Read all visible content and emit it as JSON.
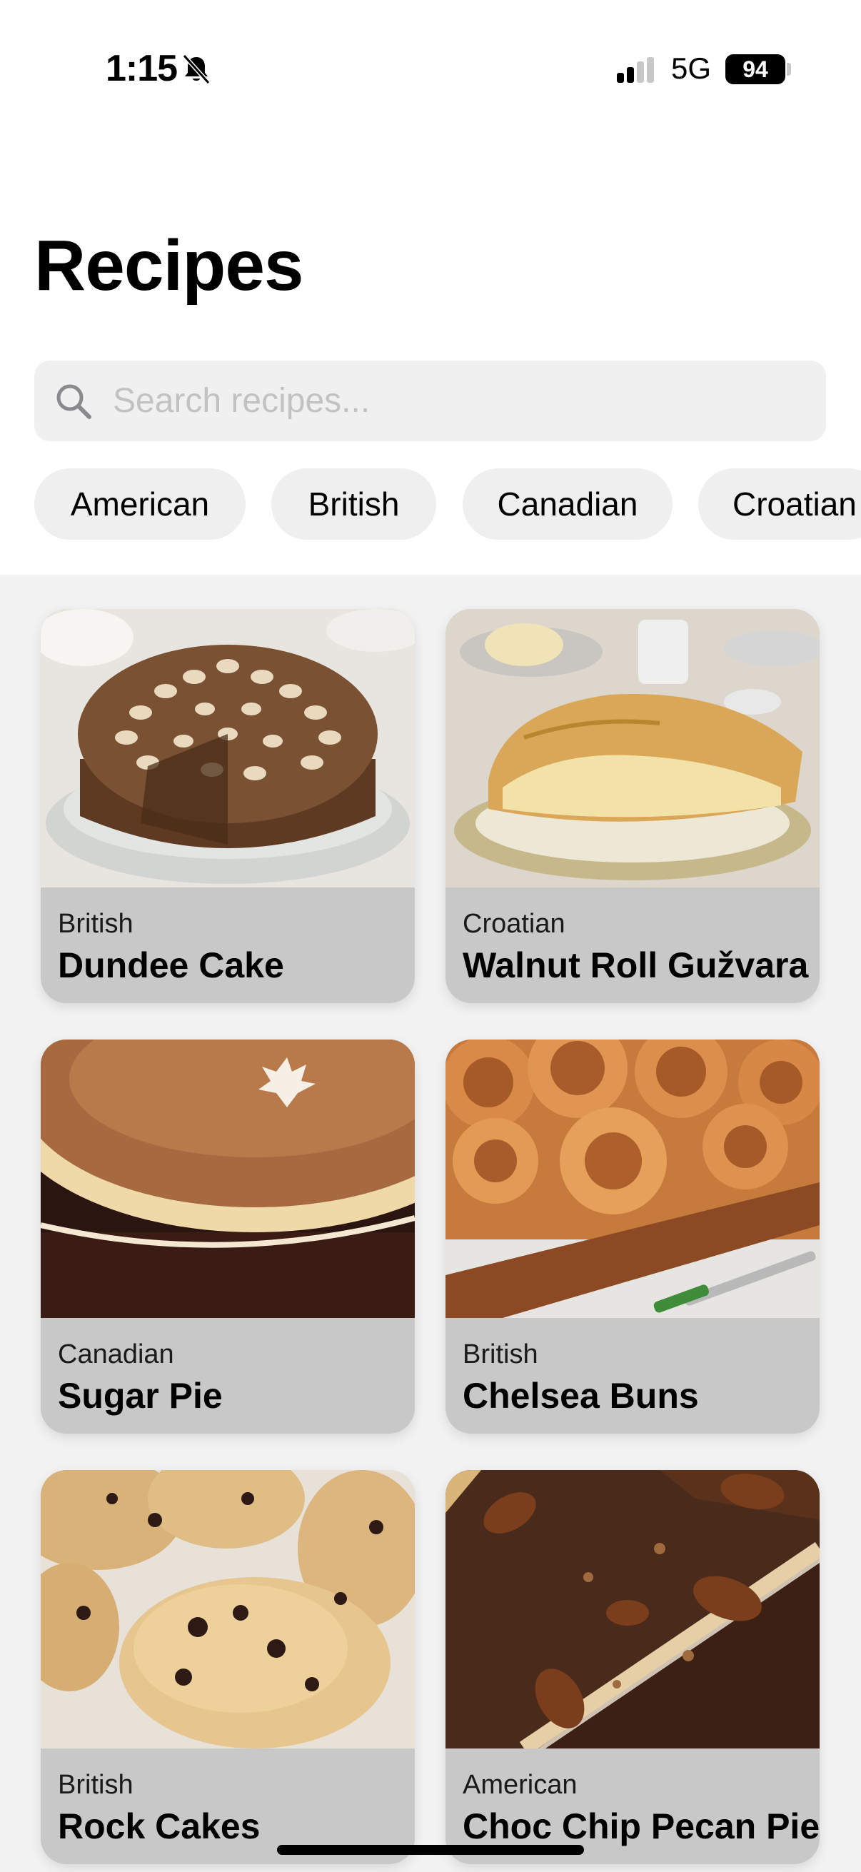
{
  "status_bar": {
    "time": "1:15",
    "network": "5G",
    "battery": "94",
    "icons": [
      "bell-muted-icon",
      "cellular-signal-icon",
      "battery-icon"
    ]
  },
  "header": {
    "title": "Recipes"
  },
  "search": {
    "placeholder": "Search recipes...",
    "value": "",
    "icon": "search-icon"
  },
  "filters": [
    {
      "label": "American"
    },
    {
      "label": "British"
    },
    {
      "label": "Canadian"
    },
    {
      "label": "Croatian"
    }
  ],
  "recipes": [
    {
      "area": "British",
      "name": "Dundee Cake",
      "image": "dundee-cake-photo"
    },
    {
      "area": "Croatian",
      "name": "Walnut Roll Gužvara",
      "image": "walnut-roll-photo"
    },
    {
      "area": "Canadian",
      "name": "Sugar Pie",
      "image": "sugar-pie-photo"
    },
    {
      "area": "British",
      "name": "Chelsea Buns",
      "image": "chelsea-buns-photo"
    },
    {
      "area": "British",
      "name": "Rock Cakes",
      "image": "rock-cakes-photo"
    },
    {
      "area": "American",
      "name": "Choc Chip Pecan Pie",
      "image": "pecan-pie-photo"
    }
  ],
  "colors": {
    "background": "#f2f2f2",
    "header_background": "#ffffff",
    "chip_background": "#efefef",
    "card_footer": "#c8c8c8",
    "placeholder": "#c2c2c2"
  }
}
